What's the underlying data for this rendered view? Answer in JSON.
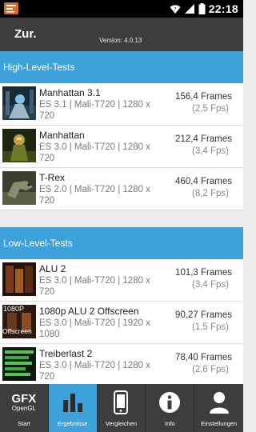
{
  "status": {
    "time": "22:18"
  },
  "appbar": {
    "back_label": "Zur.",
    "version": "Version: 4.0.13"
  },
  "sections": [
    {
      "title": "High-Level-Tests",
      "rows": [
        {
          "name": "Manhattan 3.1",
          "desc": "ES 3.1 | Mali-T720 | 1280 x 720",
          "frames": "156,4 Frames",
          "fps": "(2,5 Fps)",
          "thumb_icon": "manhattan-thumb-icon"
        },
        {
          "name": "Manhattan",
          "desc": "ES 3.0 | Mali-T720 | 1280 x 720",
          "frames": "212,4 Frames",
          "fps": "(3,4 Fps)",
          "thumb_icon": "manhattan-robot-thumb-icon"
        },
        {
          "name": "T-Rex",
          "desc": "ES 2.0 | Mali-T720 | 1280 x 720",
          "frames": "460,4 Frames",
          "fps": "(8,2 Fps)",
          "thumb_icon": "trex-thumb-icon"
        }
      ]
    },
    {
      "title": "Low-Level-Tests",
      "rows": [
        {
          "name": "ALU 2",
          "desc": "ES 3.0 | Mali-T720 | 1280 x 720",
          "frames": "101,3 Frames",
          "fps": "(3,4 Fps)",
          "thumb_icon": "alu-thumb-icon"
        },
        {
          "name": "1080p ALU 2 Offscreen",
          "desc": "ES 3.0 | Mali-T720 | 1920 x 1080",
          "frames": "90,27 Frames",
          "fps": "(1,5 Fps)",
          "thumb_icon": "alu-offscreen-thumb-icon",
          "thumb_text_top": "1080P",
          "thumb_text_bottom": "Offscreen"
        },
        {
          "name": "Treiberlast 2",
          "desc": "ES 3.0 | Mali-T720 | 1280 x 720",
          "frames": "78,40 Frames",
          "fps": "(2,6 Fps)",
          "thumb_icon": "driver-overhead-thumb-icon"
        }
      ]
    }
  ],
  "bottom_nav": {
    "start": {
      "label": "Start",
      "logo_top": "GFX",
      "logo_bottom": "OpenGL"
    },
    "results": {
      "label": "Ergebnisse"
    },
    "compare": {
      "label": "Vergleichen"
    },
    "info": {
      "label": "Info"
    },
    "settings": {
      "label": "Einstellungen"
    }
  },
  "colors": {
    "accent": "#3fa1da",
    "appbar": "#3d3d3d",
    "statusbar": "#000000"
  }
}
